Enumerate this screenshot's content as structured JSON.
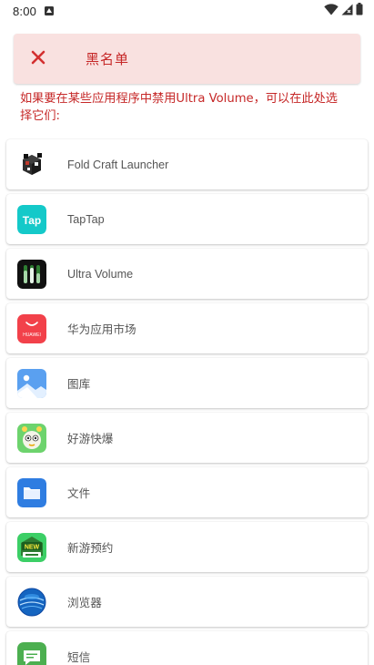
{
  "status_bar": {
    "time": "8:00"
  },
  "header": {
    "title": "黑名单"
  },
  "description": "如果要在某些应用程序中禁用Ultra Volume，可以在此处选择它们:",
  "apps": [
    {
      "name": "Fold Craft Launcher",
      "icon": "fold-craft-launcher-icon"
    },
    {
      "name": "TapTap",
      "icon": "taptap-icon"
    },
    {
      "name": "Ultra Volume",
      "icon": "ultra-volume-icon"
    },
    {
      "name": "华为应用市场",
      "icon": "huawei-appgallery-icon"
    },
    {
      "name": "图库",
      "icon": "gallery-icon"
    },
    {
      "name": "好游快爆",
      "icon": "haoyou-kuaibao-icon"
    },
    {
      "name": "文件",
      "icon": "files-folder-icon"
    },
    {
      "name": "新游预约",
      "icon": "new-game-reservation-icon"
    },
    {
      "name": "浏览器",
      "icon": "browser-icon"
    },
    {
      "name": "短信",
      "icon": "messages-icon"
    }
  ],
  "colors": {
    "accent": "#c62828",
    "header_bg": "#f9e1e0"
  }
}
